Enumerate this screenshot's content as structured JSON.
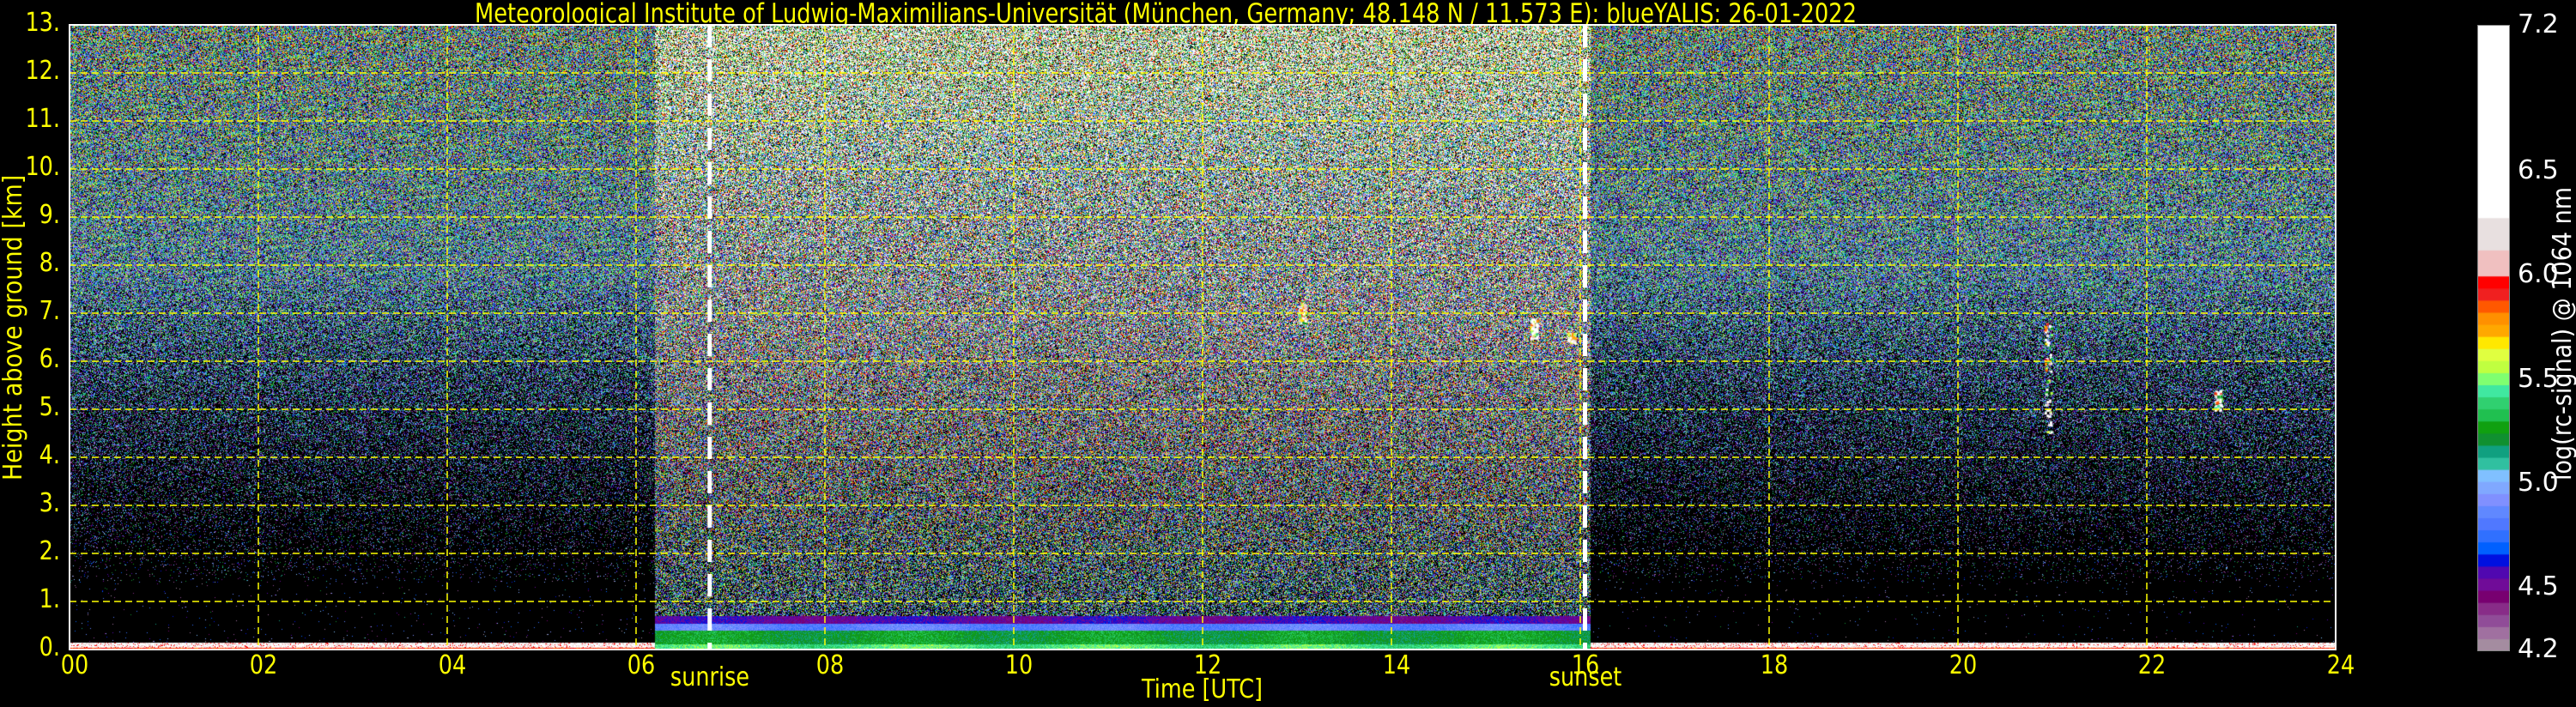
{
  "chart_data": {
    "type": "heatmap",
    "title": "Meteorological Institute of Ludwig-Maximilians-Universität (München, Germany; 48.148 N / 11.573 E):    blueYALIS: 26-01-2022",
    "xlabel": "Time [UTC]",
    "ylabel": "Height above ground [km]",
    "xlim": [
      0,
      24
    ],
    "ylim": [
      0,
      13
    ],
    "x_ticks": [
      "00",
      "02",
      "04",
      "06",
      "08",
      "10",
      "12",
      "14",
      "16",
      "18",
      "20",
      "22",
      "24"
    ],
    "y_ticks": [
      "0.",
      "1.",
      "2.",
      "3.",
      "4.",
      "5.",
      "6.",
      "7.",
      "8.",
      "9.",
      "10.",
      "11.",
      "12.",
      "13."
    ],
    "grid": true,
    "annotations": [
      {
        "label": "sunrise",
        "x": 6.78
      },
      {
        "label": "sunset",
        "x": 16.05
      }
    ],
    "layers": {
      "night_surface_layer_top_km": 0.15,
      "daytime_layer_top_km": 0.7,
      "daytime_start_h": 6.2,
      "daytime_end_h": 16.1
    },
    "clouds": [
      {
        "x": 13.05,
        "ymin": 6.8,
        "ymax": 7.2
      },
      {
        "x": 15.5,
        "ymin": 6.5,
        "ymax": 6.9
      },
      {
        "x": 15.9,
        "ymin": 6.4,
        "ymax": 6.6
      },
      {
        "x": 20.95,
        "ymin": 4.5,
        "ymax": 6.8
      },
      {
        "x": 22.75,
        "ymin": 5.0,
        "ymax": 5.4
      }
    ],
    "colorbar": {
      "label": "log(rc-signal) @ 1064 nm",
      "range": [
        4.2,
        7.2
      ],
      "ticks": [
        "4.2",
        "4.5",
        "5.0",
        "5.5",
        "6.0",
        "6.5",
        "7.2"
      ],
      "tick_values": [
        4.2,
        4.5,
        5.0,
        5.5,
        6.0,
        6.5,
        7.2
      ],
      "colors_4_2_to_6_0": [
        "#a48ca0",
        "#a070a0",
        "#904c98",
        "#882c88",
        "#780070",
        "#700c98",
        "#5008b0",
        "#0010e0",
        "#0060ff",
        "#3070ff",
        "#5078ff",
        "#6088ff",
        "#8090ff",
        "#80a8ff",
        "#80c0ff",
        "#30c0a0",
        "#10a080",
        "#109030",
        "#10a010",
        "#20c050",
        "#30d070",
        "#40e8a0",
        "#80ff70",
        "#c0ff40",
        "#e0ff40",
        "#ffe800",
        "#ffa800",
        "#ff9000",
        "#ff5800",
        "#f02020",
        "#ff0000"
      ],
      "upper_bins": [
        {
          "from": 6.0,
          "to": 6.125,
          "color": "#f0c0c0"
        },
        {
          "from": 6.125,
          "to": 6.28,
          "color": "#e8e0e0"
        },
        {
          "from": 6.28,
          "to": 7.2,
          "color": "#ffffff"
        }
      ]
    }
  },
  "colors": {
    "axis_text": "#ffff00",
    "grid": "#ffff00",
    "annotation_line": "#ffffff",
    "background": "#000000"
  }
}
